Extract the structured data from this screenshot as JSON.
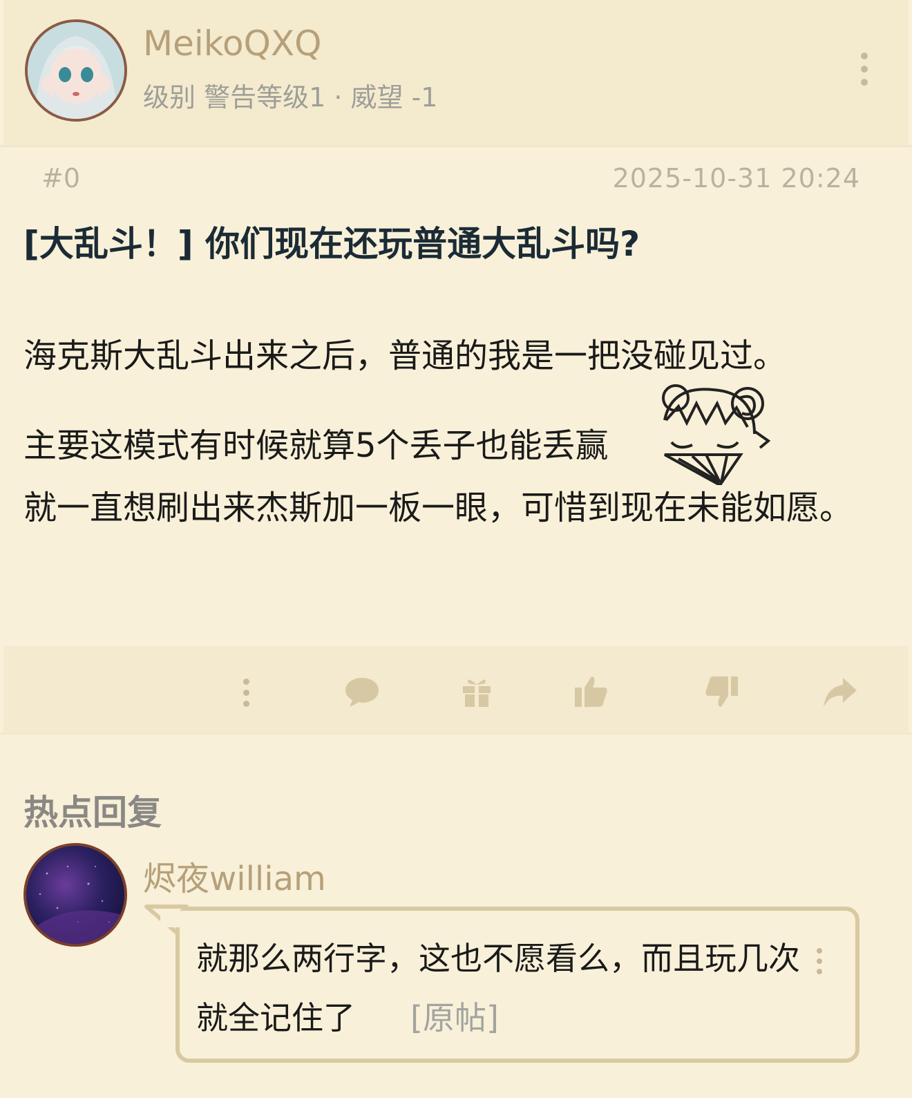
{
  "post": {
    "author": {
      "name": "MeikoQXQ",
      "level_line": "级别 警告等级1 · 威望 -1"
    },
    "floor": "#0",
    "timestamp": "2025-10-31 20:24",
    "title": "[大乱斗！] 你们现在还玩普通大乱斗吗?",
    "paragraphs": [
      "海克斯大乱斗出来之后，普通的我是一把没碰见过。",
      "主要这模式有时候就算5个丢子也能丢赢",
      "就一直想刷出来杰斯加一板一眼，可惜到现在未能如愿。"
    ]
  },
  "actions": {
    "icons": [
      "more-icon",
      "comment-icon",
      "gift-icon",
      "thumb-up-icon",
      "thumb-down-icon",
      "share-icon"
    ]
  },
  "hot_replies": {
    "heading": "热点回复",
    "items": [
      {
        "author": "烬夜william",
        "text": "就那么两行字，这也不愿看么，而且玩几次就全记住了",
        "original_link": "[原帖]"
      }
    ]
  },
  "colors": {
    "background": "#f8f0d8",
    "username": "#b5a07a",
    "icon": "#c9b99a"
  }
}
